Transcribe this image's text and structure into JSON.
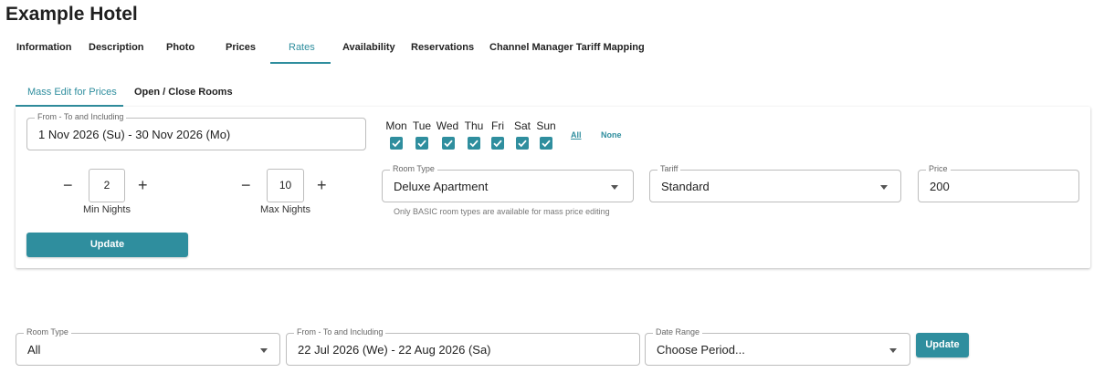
{
  "hotel_name": "Example Hotel",
  "tabs": [
    "Information",
    "Description",
    "Photo",
    "Prices",
    "Rates",
    "Availability",
    "Reservations",
    "Channel Manager Tariff Mapping"
  ],
  "subtabs": [
    "Mass Edit for Prices",
    "Open / Close Rooms"
  ],
  "mass_edit": {
    "date_range": {
      "label": "From - To and Including",
      "value": "1 Nov 2026 (Su) -  30 Nov 2026 (Mo)"
    },
    "days": [
      {
        "label": "Mon",
        "checked": true
      },
      {
        "label": "Tue",
        "checked": true
      },
      {
        "label": "Wed",
        "checked": true
      },
      {
        "label": "Thu",
        "checked": true
      },
      {
        "label": "Fri",
        "checked": true
      },
      {
        "label": "Sat",
        "checked": true
      },
      {
        "label": "Sun",
        "checked": true
      }
    ],
    "all_label": "All",
    "none_label": "None",
    "min_nights": {
      "minus": "−",
      "value": "2",
      "plus": "+",
      "caption": "Min Nights"
    },
    "max_nights": {
      "minus": "−",
      "value": "10",
      "plus": "+",
      "caption": "Max Nights"
    },
    "room_type": {
      "label": "Room Type",
      "value": "Deluxe Apartment",
      "help": "Only BASIC room types are available for mass price editing"
    },
    "tariff": {
      "label": "Tariff",
      "value": "Standard"
    },
    "price": {
      "label": "Price",
      "value": "200"
    },
    "update_label": "Update"
  },
  "filter": {
    "room_type": {
      "label": "Room Type",
      "value": "All"
    },
    "date_range": {
      "label": "From - To and Including",
      "value": "22 Jul 2026 (We) -  22 Aug 2026 (Sa)"
    },
    "period": {
      "label": "Date Range",
      "value": "Choose Period..."
    },
    "update_label": "Update"
  },
  "colors": {
    "accent": "#2f8e9e",
    "border": "#bdbdbd"
  }
}
